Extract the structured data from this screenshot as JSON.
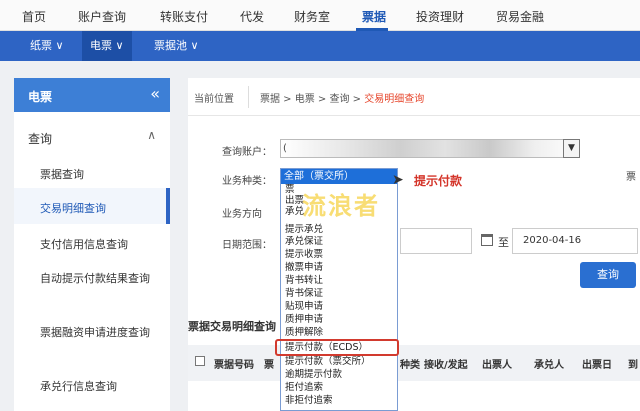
{
  "top_nav": [
    {
      "label": "首页",
      "active": false
    },
    {
      "label": "账户查询",
      "active": false
    },
    {
      "label": "转账支付",
      "active": false
    },
    {
      "label": "代发",
      "active": false
    },
    {
      "label": "财务室",
      "active": false
    },
    {
      "label": "票据",
      "active": true
    },
    {
      "label": "投资理财",
      "active": false
    },
    {
      "label": "贸易金融",
      "active": false
    }
  ],
  "sub_nav": [
    {
      "label": "纸票 ∨",
      "active": false
    },
    {
      "label": "电票 ∨",
      "active": true
    },
    {
      "label": "票据池 ∨",
      "active": false
    }
  ],
  "sidebar": {
    "title": "电票",
    "collapse_icon": "«",
    "group": "查询",
    "group_caret": "∧",
    "items": [
      "票据查询",
      "交易明细查询",
      "支付信用信息查询",
      "自动提示付款结果查询",
      "票据融资申请进度查询",
      "承兑行信息查询"
    ],
    "active_index": 1
  },
  "breadcrumb": {
    "position_label": "当前位置",
    "path": "票据 > 电票 > 查询 > ",
    "current": "交易明细查询"
  },
  "form": {
    "account_label": "查询账户：",
    "account_prefix": "(",
    "business_type_label": "业务种类：",
    "business_direction_label": "业务方向",
    "date_range_label": "日期范围：",
    "to_label": "至",
    "end_date": "2020-04-16",
    "query_button": "查询",
    "hint": "提示付款",
    "right_cut_text": "票"
  },
  "dropdown": {
    "selected": "全部（票交所）",
    "options": [
      "票",
      "出票",
      "承兑",
      "提示承兑",
      "承兑保证",
      "提示收票",
      "撤票申请",
      "背书转让",
      "背书保证",
      "贴现申请",
      "质押申请",
      "质押解除",
      "提示付款（ECDS）",
      "提示付款（票交所）",
      "逾期提示付款",
      "拒付追索",
      "非拒付追索"
    ],
    "highlighted": "提示付款（ECDS）"
  },
  "table": {
    "title": "票据交易明细查询",
    "columns": [
      "票据号码",
      "票",
      "种类",
      "接收/发起",
      "出票人",
      "承兑人",
      "出票日",
      "到"
    ]
  },
  "watermark": "流浪者"
}
